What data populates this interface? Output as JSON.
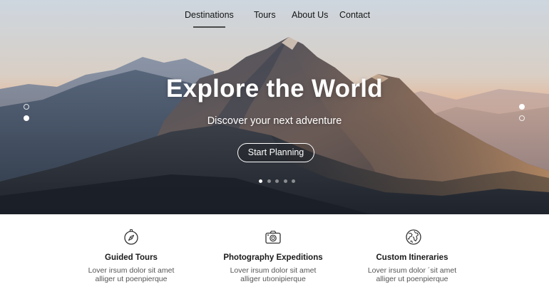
{
  "nav": {
    "items": [
      {
        "label": "Destinations",
        "active": true
      },
      {
        "label": "Tours",
        "active": false
      },
      {
        "label": "About Us",
        "active": false
      },
      {
        "label": "Contact",
        "active": false
      }
    ]
  },
  "hero": {
    "title": "Explore the World",
    "subtitle": "Discover your next adventure",
    "cta_label": "Start Planning",
    "carousel": {
      "count": 5,
      "active_index": 0
    }
  },
  "features": [
    {
      "icon": "compass-icon",
      "title": "Guided Tours",
      "desc_line1": "Lover irsum dolor sit amet",
      "desc_line2": "alliger ut poenpierque"
    },
    {
      "icon": "camera-icon",
      "title": "Photography Expeditions",
      "desc_line1": "Lover irsum dolor sit amet",
      "desc_line2": "alliger utıonipierque"
    },
    {
      "icon": "globe-icon",
      "title": "Custom Itineraries",
      "desc_line1": "Lover irsum dolor ´sit amet",
      "desc_line2": "alliger ut poenpierque"
    }
  ],
  "colors": {
    "sky_top": "#c8d3de",
    "sky_horizon": "#e9a26a",
    "mountain_dark": "#2b3440",
    "text_white": "#ffffff",
    "text_dark": "#1a1a1a"
  }
}
